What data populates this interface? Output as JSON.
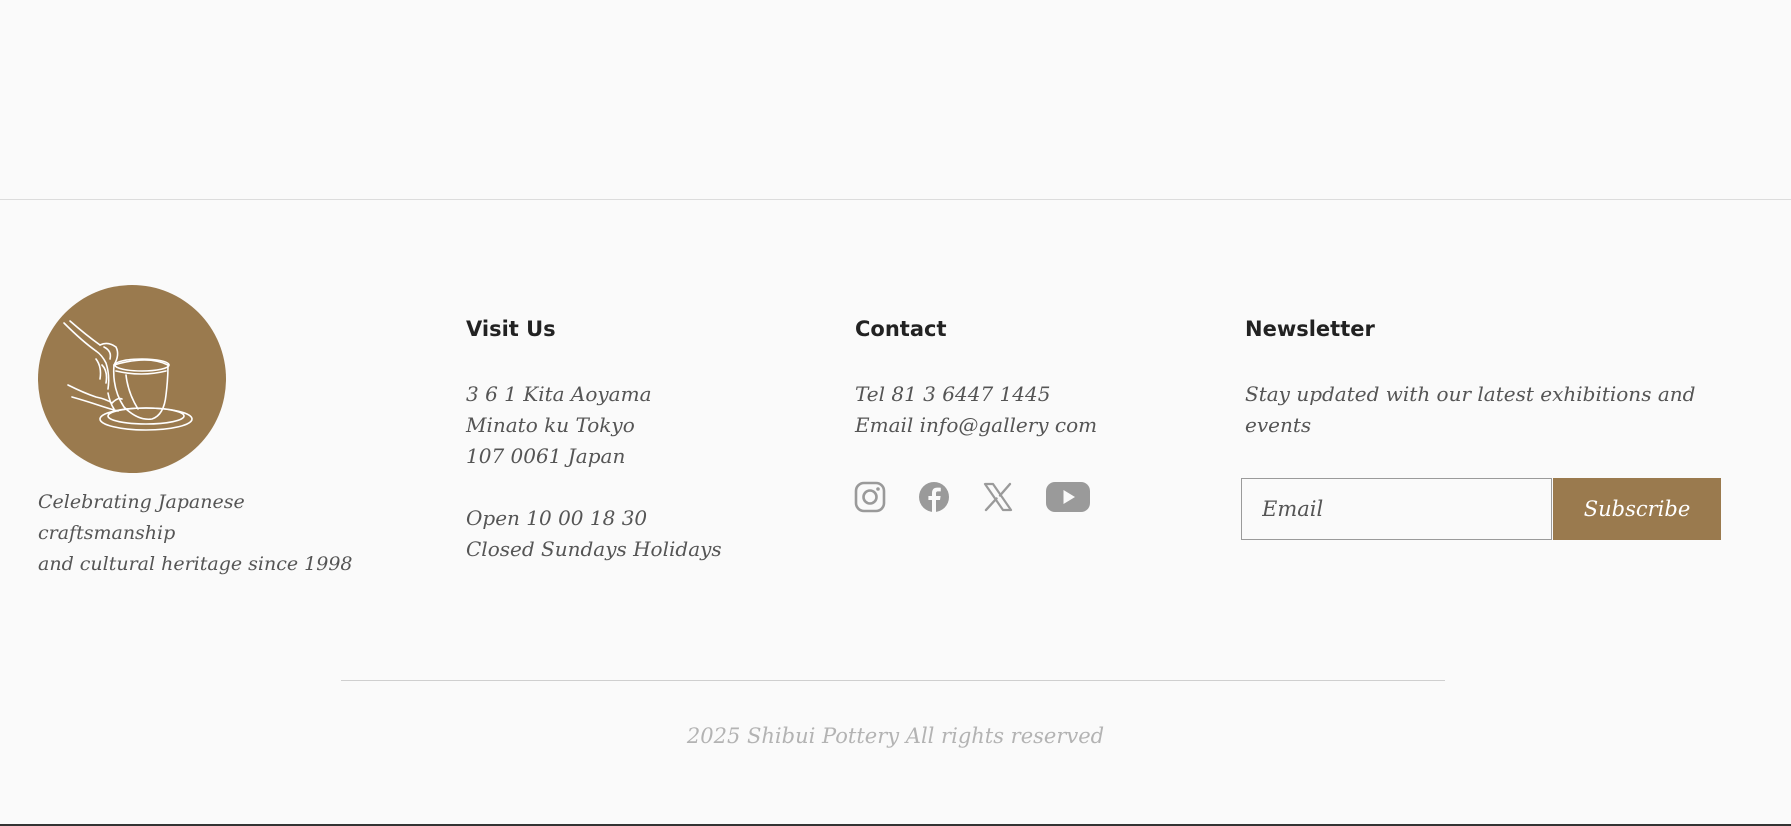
{
  "brand": {
    "tagline_line1": "Celebrating Japanese craftsmanship",
    "tagline_line2": "and cultural heritage since 1998",
    "logo_icon": "pottery-wheel-hands-icon",
    "accent_color": "#9a7a4e"
  },
  "visit": {
    "heading": "Visit Us",
    "address_line1": "3 6 1 Kita Aoyama",
    "address_line2": "Minato ku  Tokyo",
    "address_line3": "107  0061 Japan",
    "hours_line1": "Open  10 00    18 30",
    "hours_line2": "Closed  Sundays    Holidays"
  },
  "contact": {
    "heading": "Contact",
    "tel": "Tel    81 3  6447  1445",
    "email": "Email  info@gallery com",
    "social": [
      "instagram-icon",
      "facebook-icon",
      "x-icon",
      "youtube-icon"
    ]
  },
  "newsletter": {
    "heading": "Newsletter",
    "text": "Stay updated with our latest exhibitions and events",
    "email_placeholder": "Email",
    "subscribe_label": "Subscribe"
  },
  "footer": {
    "copyright": "2025 Shibui Pottery  All rights reserved"
  }
}
